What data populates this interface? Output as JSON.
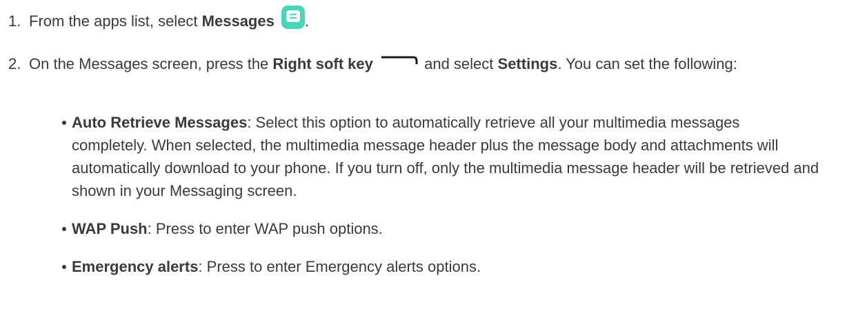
{
  "steps": [
    {
      "number": "1.",
      "prefix": "From the apps list, select ",
      "bold": "Messages",
      "icon": "messages-app-icon",
      "suffix": "."
    },
    {
      "number": "2.",
      "prefix": "On the Messages screen, press the ",
      "bold_key": "Right soft key",
      "icon": "right-soft-key-icon",
      "middle": " and select ",
      "bold_settings": "Settings",
      "suffix": ". You can set the following:"
    }
  ],
  "options": [
    {
      "name": "Auto Retrieve Messages",
      "description": ": Select this option to automatically retrieve all your multimedia messages completely. When selected, the multimedia message header plus the message body and attachments will automatically download to your phone. If you turn off, only the multimedia message header will be retrieved and shown in your Messaging screen."
    },
    {
      "name": "WAP Push",
      "description": ": Press to enter WAP push options."
    },
    {
      "name": "Emergency alerts",
      "description": ": Press to enter Emergency alerts options."
    }
  ],
  "colors": {
    "text": "#3a3a3a",
    "icon_bg": "#47d6bb"
  }
}
